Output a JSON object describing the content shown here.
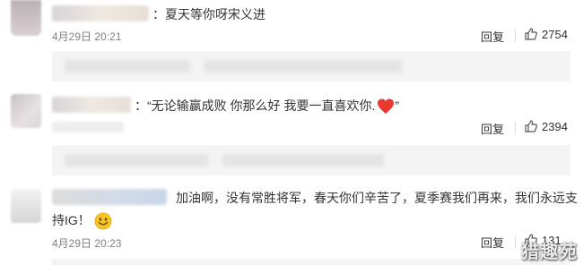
{
  "comments": [
    {
      "text": "：夏天等你呀宋义进",
      "time": "4月29日 20:21",
      "reply_label": "回复",
      "likes": "2754"
    },
    {
      "text": "：“无论输赢成败 你那么好 我要一直喜欢你.",
      "text_end": "”",
      "emoji": "heart-emoji",
      "time": "",
      "reply_label": "回复",
      "likes": "2394"
    },
    {
      "text_line1": "加油啊，没有常胜将军，春天你们辛苦了，夏季赛我们再来，我们永远支",
      "text_line2": "持IG！",
      "emoji": "smiley-emoji",
      "time": "4月29日 20:23",
      "reply_label": "回复",
      "likes": "131"
    }
  ],
  "watermark": "猎趣苑",
  "colors": {
    "text": "#333333",
    "time": "#808080",
    "subbox_bg": "#f4f4f4",
    "heart": "#e8392f",
    "smiley": "#f7c325"
  }
}
